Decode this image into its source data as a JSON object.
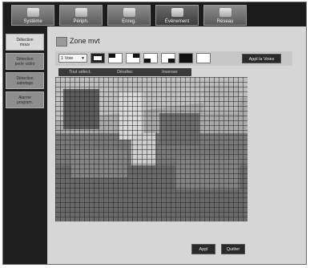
{
  "tabs": [
    {
      "label": "Système",
      "icon": "monitor-icon"
    },
    {
      "label": "Périph.",
      "icon": "camera-icon"
    },
    {
      "label": "Enreg.",
      "icon": "recorder-icon"
    },
    {
      "label": "Événement",
      "icon": "event-icon"
    },
    {
      "label": "Réseau",
      "icon": "network-icon"
    }
  ],
  "sidebar": {
    "items": [
      {
        "line1": "Détection",
        "line2": "mouv"
      },
      {
        "line1": "Détection",
        "line2": "perte vidéo"
      },
      {
        "line1": "Détection",
        "line2": "sabotage"
      },
      {
        "line1": "Alarme",
        "line2": "program."
      }
    ]
  },
  "page": {
    "title": "Zone mvt"
  },
  "toolbar": {
    "channel": "1 Voie",
    "apply_label": "Appl la Voies"
  },
  "actions": [
    "Tout sélect.",
    "Désélec",
    "Inverser"
  ],
  "footer": {
    "ok_label": "Appl",
    "cancel_label": "Quitter"
  },
  "colors": {
    "active_tab": "#3c3c3c",
    "sidebar_active": "#d9d9d9",
    "dark_bg": "#1c1c1c"
  }
}
